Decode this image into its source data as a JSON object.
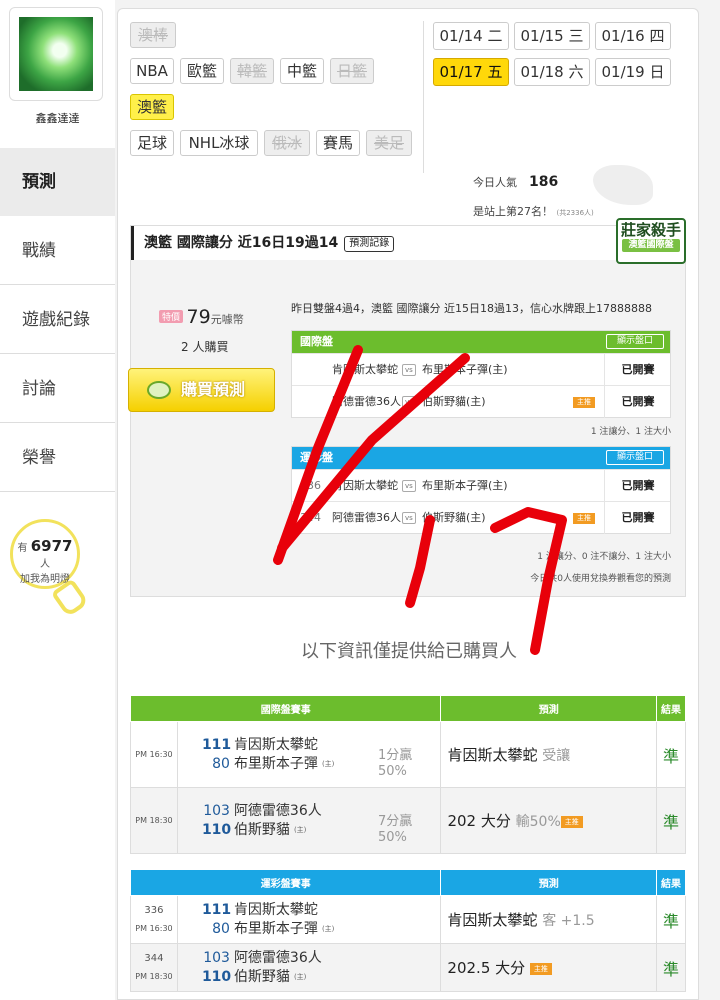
{
  "profile": {
    "name": "鑫鑫達達"
  },
  "nav": [
    {
      "label": "預測",
      "active": true
    },
    {
      "label": "戰績"
    },
    {
      "label": "遊戲紀錄"
    },
    {
      "label": "討論"
    },
    {
      "label": "榮譽"
    }
  ],
  "fans": {
    "prefix": "有",
    "count": "6977",
    "suffix": "人",
    "label": "加我為明燈"
  },
  "sports": [
    {
      "label": "澳棒",
      "state": "disabled"
    },
    {
      "label": "NBA"
    },
    {
      "label": "歐籃"
    },
    {
      "label": "韓籃",
      "state": "disabled"
    },
    {
      "label": "中籃"
    },
    {
      "label": "日籃",
      "state": "disabled"
    },
    {
      "label": "澳籃",
      "state": "selected"
    },
    {
      "label": "足球"
    },
    {
      "label": "NHL冰球"
    },
    {
      "label": "俄冰",
      "state": "disabled"
    },
    {
      "label": "賽馬"
    },
    {
      "label": "美足",
      "state": "disabled"
    }
  ],
  "dates": [
    {
      "date": "01/14",
      "day": "二"
    },
    {
      "date": "01/15",
      "day": "三"
    },
    {
      "date": "01/16",
      "day": "四"
    },
    {
      "date": "01/17",
      "day": "五",
      "selected": true
    },
    {
      "date": "01/18",
      "day": "六"
    },
    {
      "date": "01/19",
      "day": "日"
    }
  ],
  "stats": {
    "popularity_label": "今日人氣",
    "popularity": "186",
    "rank_text": "是站上第27名！",
    "rank_total": "(共2336人)"
  },
  "prediction": {
    "header": "澳籃 國際讓分 近16日19過14",
    "record_btn": "預測記錄",
    "badge_title": "莊家殺手",
    "badge_sub": "澳籃國際盤",
    "price_tag": "特價",
    "price": "79",
    "price_unit": "元噱幣",
    "buyers": "2 人購買",
    "buy_btn": "購買預測",
    "yesterday": "昨日雙盤4過4，澳籃 國際讓分 近15日18過13，信心水牌跟上17888888",
    "intl": {
      "title": "國際盤",
      "show_btn": "顯示盤口",
      "rows": [
        {
          "no": "",
          "team1": "肯因斯太攀蛇",
          "team2": "布里斯本子彈(主)",
          "marker": "",
          "result": "已開賽"
        },
        {
          "no": "",
          "team1": "阿德雷德36人",
          "team2": "伯斯野貓(主)",
          "marker": "主推",
          "result": "已開賽"
        }
      ],
      "note": "1 注讓分、1 注大小"
    },
    "lottery": {
      "title": "運彩盤",
      "show_btn": "顯示盤口",
      "rows": [
        {
          "no": "336",
          "team1": "肯因斯太攀蛇",
          "team2": "布里斯本子彈(主)",
          "marker": "",
          "result": "已開賽"
        },
        {
          "no": "344",
          "team1": "阿德雷德36人",
          "team2": "伯斯野貓(主)",
          "marker": "主推",
          "result": "已開賽"
        }
      ],
      "note": "1 注讓分、0 注不讓分、1 注大小",
      "note2": "今日共0人使用兌換券觀看您的預測"
    }
  },
  "info_text": "以下資訊僅提供給已購買人",
  "intl_table": {
    "headers": [
      "國際盤賽事",
      "預測",
      "結果"
    ],
    "rows": [
      {
        "time": "PM 16:30",
        "score1": "111",
        "team1": "肯因斯太攀蛇",
        "score2": "80",
        "team2": "布里斯本子彈",
        "home": "(主)",
        "hc1": "1分贏",
        "hc2": "50%",
        "pred": "肯因斯太攀蛇",
        "pred_extra": "受讓",
        "marker": "",
        "result": "準"
      },
      {
        "time": "PM 18:30",
        "score1": "103",
        "team1": "阿德雷德36人",
        "score2": "110",
        "team2": "伯斯野貓",
        "home": "(主)",
        "hc1": "7分贏",
        "hc2": "50%",
        "pred": "202 大分",
        "pred_extra": "輸50%",
        "marker": "主推",
        "result": "準"
      }
    ]
  },
  "lottery_table": {
    "headers": [
      "運彩盤賽事",
      "預測",
      "結果"
    ],
    "rows": [
      {
        "no": "336",
        "time": "PM 16:30",
        "score1": "111",
        "team1": "肯因斯太攀蛇",
        "score2": "80",
        "team2": "布里斯本子彈",
        "home": "(主)",
        "pred": "肯因斯太攀蛇",
        "pred_extra": "客 +1.5",
        "marker": "",
        "result": "準"
      },
      {
        "no": "344",
        "time": "PM 18:30",
        "score1": "103",
        "team1": "阿德雷德36人",
        "score2": "110",
        "team2": "伯斯野貓",
        "home": "(主)",
        "pred": "202.5 大分",
        "pred_extra": "",
        "marker": "主推",
        "result": "準"
      }
    ]
  },
  "colors": {
    "intl_green": "#6cbd2d",
    "lottery_blue": "#1aa6e4",
    "scribble_red": "#e8000a",
    "selected_yellow": "#ffd80a"
  }
}
